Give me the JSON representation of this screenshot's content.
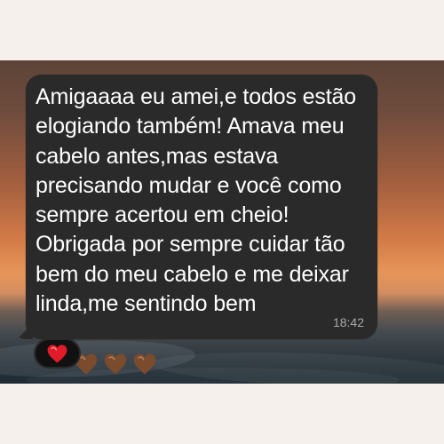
{
  "message": {
    "text": "Amigaaaa eu amei,e todos estão\nelogiando também! Amava meu\ncabelo antes,mas estava\nprecisando mudar e você como\nsempre acertou em cheio!\nObrigada por sempre cuidar tão\nbem do meu cabelo e me deixar\nlinda,me sentindo bem ",
    "hearts": [
      {
        "icon": "brown-heart-icon",
        "color": "#7a4a2c"
      },
      {
        "icon": "brown-heart-icon",
        "color": "#7a4a2c"
      },
      {
        "icon": "brown-heart-icon",
        "color": "#7a4a2c"
      }
    ],
    "time": "18:42"
  },
  "reaction": {
    "icon": "red-heart-icon",
    "color": "#e0242f"
  },
  "colors": {
    "bubble": "#2a2a2a",
    "reaction_bg": "#111111",
    "timestamp": "#a9a9a9"
  }
}
